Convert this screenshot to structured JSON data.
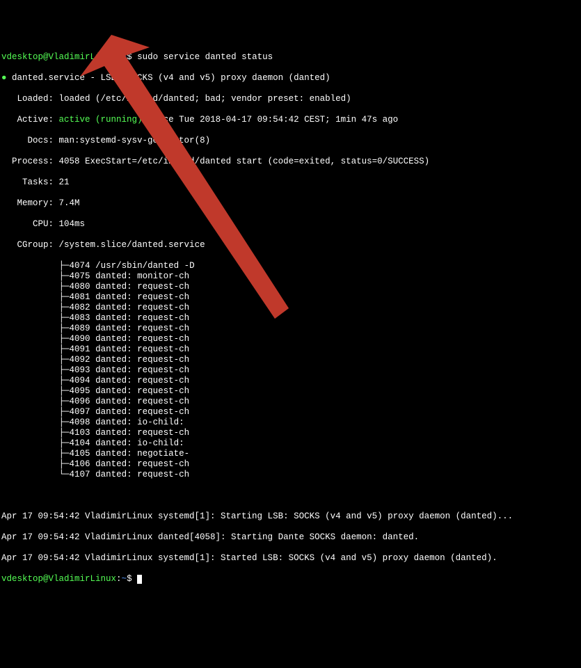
{
  "prompt": {
    "user_host": "vdesktop@VladimirLinux",
    "path": "~",
    "symbol": "$",
    "command": "sudo service danted status"
  },
  "service": {
    "bullet": "●",
    "header": "danted.service - LSB: SOCKS (v4 and v5) proxy daemon (danted)",
    "loaded_label": "   Loaded:",
    "loaded_value": "loaded (/etc/init.d/danted; bad; vendor preset: enabled)",
    "active_label": "   Active:",
    "active_status": "active (running)",
    "active_since": "since Tue 2018-04-17 09:54:42 CEST; 1min 47s ago",
    "docs_label": "     Docs:",
    "docs_value": "man:systemd-sysv-generator(8)",
    "process_label": "  Process:",
    "process_value": "4058 ExecStart=/etc/init.d/danted start (code=exited, status=0/SUCCESS)",
    "tasks_label": "    Tasks:",
    "tasks_value": "21",
    "memory_label": "   Memory:",
    "memory_value": "7.4M",
    "cpu_label": "      CPU:",
    "cpu_value": "104ms",
    "cgroup_label": "   CGroup:",
    "cgroup_value": "/system.slice/danted.service"
  },
  "tree": [
    {
      "pid": "4074",
      "cmd": "/usr/sbin/danted -D"
    },
    {
      "pid": "4075",
      "cmd": "danted: monitor-ch"
    },
    {
      "pid": "4080",
      "cmd": "danted: request-ch"
    },
    {
      "pid": "4081",
      "cmd": "danted: request-ch"
    },
    {
      "pid": "4082",
      "cmd": "danted: request-ch"
    },
    {
      "pid": "4083",
      "cmd": "danted: request-ch"
    },
    {
      "pid": "4089",
      "cmd": "danted: request-ch"
    },
    {
      "pid": "4090",
      "cmd": "danted: request-ch"
    },
    {
      "pid": "4091",
      "cmd": "danted: request-ch"
    },
    {
      "pid": "4092",
      "cmd": "danted: request-ch"
    },
    {
      "pid": "4093",
      "cmd": "danted: request-ch"
    },
    {
      "pid": "4094",
      "cmd": "danted: request-ch"
    },
    {
      "pid": "4095",
      "cmd": "danted: request-ch"
    },
    {
      "pid": "4096",
      "cmd": "danted: request-ch"
    },
    {
      "pid": "4097",
      "cmd": "danted: request-ch"
    },
    {
      "pid": "4098",
      "cmd": "danted: io-child:"
    },
    {
      "pid": "4103",
      "cmd": "danted: request-ch"
    },
    {
      "pid": "4104",
      "cmd": "danted: io-child:"
    },
    {
      "pid": "4105",
      "cmd": "danted: negotiate-"
    },
    {
      "pid": "4106",
      "cmd": "danted: request-ch"
    },
    {
      "pid": "4107",
      "cmd": "danted: request-ch"
    }
  ],
  "log": {
    "l1": "Apr 17 09:54:42 VladimirLinux systemd[1]: Starting LSB: SOCKS (v4 and v5) proxy daemon (danted)...",
    "l2": "Apr 17 09:54:42 VladimirLinux danted[4058]: Starting Dante SOCKS daemon: danted.",
    "l3": "Apr 17 09:54:42 VladimirLinux systemd[1]: Started LSB: SOCKS (v4 and v5) proxy daemon (danted)."
  },
  "prompt2": {
    "user_host": "vdesktop@VladimirLinux",
    "path": "~",
    "symbol": "$"
  },
  "annotation": {
    "arrow_color": "#c0392b"
  }
}
